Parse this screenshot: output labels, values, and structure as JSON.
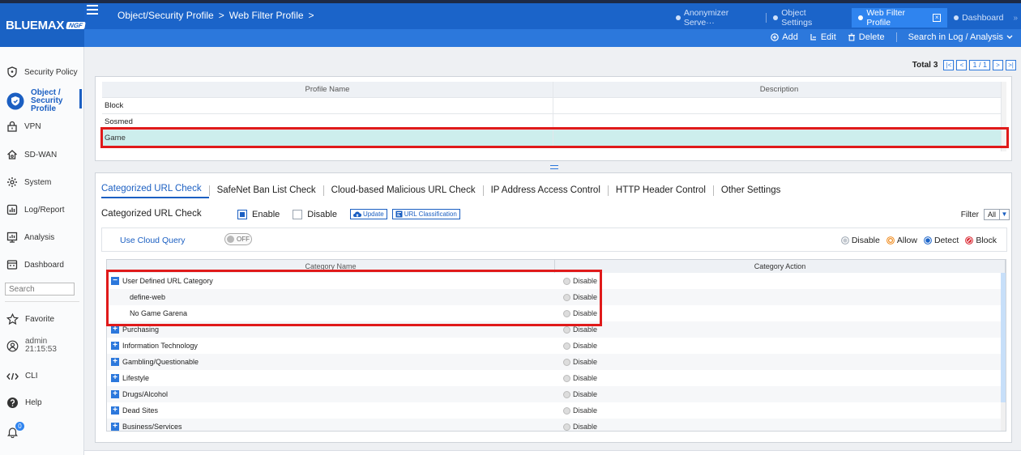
{
  "brand": {
    "name": "BLUEMAX",
    "badge": "NGF"
  },
  "breadcrumb": {
    "part1": "Object/Security Profile",
    "sep1": ">",
    "part2": "Web Filter Profile",
    "sep2": ">"
  },
  "open_tabs": [
    {
      "label": "Anonymizer Serve···"
    },
    {
      "label": "Object Settings"
    },
    {
      "label": "Web Filter Profile"
    },
    {
      "label": "Dashboard"
    }
  ],
  "more_tabs": "»",
  "toolbar": {
    "add": "Add",
    "edit": "Edit",
    "delete": "Delete",
    "search_log": "Search in Log / Analysis"
  },
  "sidebar": {
    "items": [
      {
        "label": "Security Policy",
        "icon": "shield-icon"
      },
      {
        "label": "Object /",
        "label2": "Security Profile",
        "icon": "security-profile-icon"
      },
      {
        "label": "VPN",
        "icon": "lock-icon"
      },
      {
        "label": "SD-WAN",
        "icon": "network-home-icon"
      },
      {
        "label": "System",
        "icon": "gear-icon"
      },
      {
        "label": "Log/Report",
        "icon": "report-icon"
      },
      {
        "label": "Analysis",
        "icon": "analysis-icon"
      },
      {
        "label": "Dashboard",
        "icon": "dashboard-icon"
      }
    ],
    "search_placeholder": "Search",
    "favorite": "Favorite",
    "user": "admin",
    "time": "21:15:53",
    "cli": "CLI",
    "help": "Help",
    "notifications": "0"
  },
  "pagination": {
    "total_label": "Total",
    "total": "3",
    "page": "1 / 1"
  },
  "profile_table": {
    "headers": [
      "Profile Name",
      "Description"
    ],
    "rows": [
      {
        "name": "Block",
        "description": ""
      },
      {
        "name": "Sosmed",
        "description": ""
      },
      {
        "name": "Game",
        "description": "",
        "selected": true
      }
    ]
  },
  "subtabs": [
    "Categorized URL Check",
    "SafeNet Ban List Check",
    "Cloud-based Malicious URL Check",
    "IP Address Access Control",
    "HTTP Header Control",
    "Other Settings"
  ],
  "check": {
    "label": "Categorized URL Check",
    "enable": "Enable",
    "disable": "Disable",
    "selected": "Enable",
    "update_btn": "Update",
    "classification_btn": "URL Classification",
    "filter_label": "Filter",
    "filter_value": "All"
  },
  "cloud_query": {
    "label": "Use Cloud Query",
    "toggle": "OFF"
  },
  "action_legend": [
    "Disable",
    "Allow",
    "Detect",
    "Block"
  ],
  "legend_colors": {
    "Disable": "#9aa4b0",
    "Allow": "#f08a1c",
    "Detect": "#1b64c9",
    "Block": "#d9232d"
  },
  "category_table": {
    "headers": [
      "Category Name",
      "Category Action"
    ],
    "rows": [
      {
        "name": "User Defined URL Category",
        "expander": "−",
        "action": "Disable",
        "child": false
      },
      {
        "name": "define-web",
        "expander": "",
        "action": "Disable",
        "child": true
      },
      {
        "name": "No Game Garena",
        "expander": "",
        "action": "Disable",
        "child": true
      },
      {
        "name": "Purchasing",
        "expander": "+",
        "action": "Disable",
        "child": false
      },
      {
        "name": "Information Technology",
        "expander": "+",
        "action": "Disable",
        "child": false
      },
      {
        "name": "Gambling/Questionable",
        "expander": "+",
        "action": "Disable",
        "child": false
      },
      {
        "name": "Lifestyle",
        "expander": "+",
        "action": "Disable",
        "child": false
      },
      {
        "name": "Drugs/Alcohol",
        "expander": "+",
        "action": "Disable",
        "child": false
      },
      {
        "name": "Dead Sites",
        "expander": "+",
        "action": "Disable",
        "child": false
      },
      {
        "name": "Business/Services",
        "expander": "+",
        "action": "Disable",
        "child": false
      }
    ]
  }
}
